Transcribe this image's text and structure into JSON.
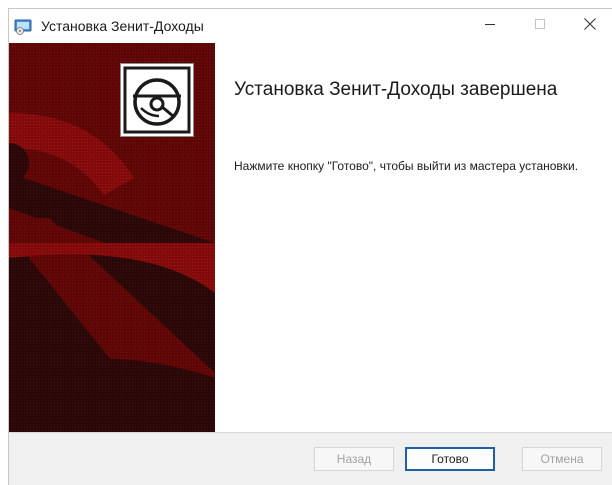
{
  "window": {
    "title": "Установка Зенит-Доходы",
    "controls": {
      "minimize_icon": "minimize-icon",
      "maximize_icon": "maximize-icon",
      "close_icon": "close-icon"
    }
  },
  "banner": {
    "logo_icon": "disc-install-icon",
    "accent_color": "#6b0a0a"
  },
  "main": {
    "heading": "Установка Зенит-Доходы завершена",
    "message": "Нажмите кнопку \"Готово\", чтобы выйти из мастера установки."
  },
  "footer": {
    "back_label": "Назад",
    "finish_label": "Готово",
    "cancel_label": "Отмена"
  }
}
